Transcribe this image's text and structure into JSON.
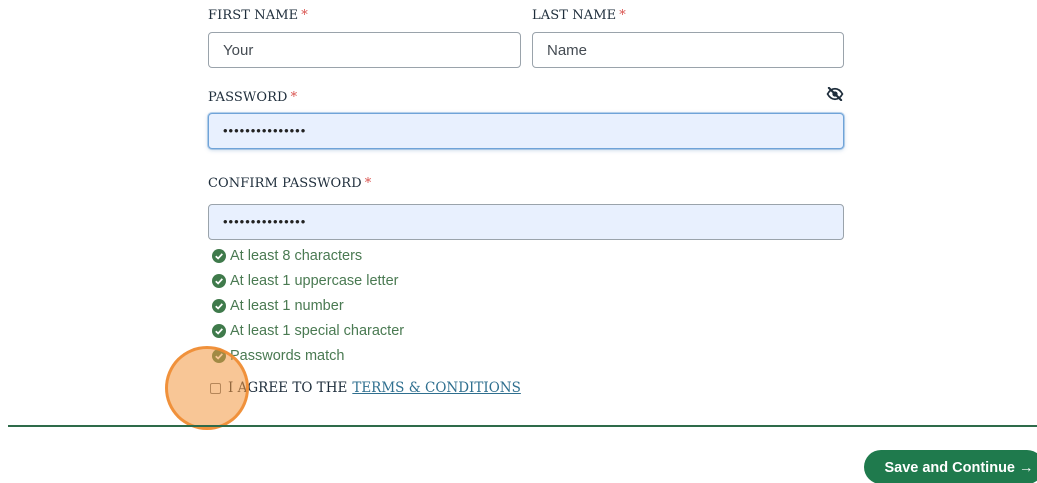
{
  "form": {
    "first_name": {
      "label": "FIRST NAME",
      "required_mark": "*",
      "value": "Your"
    },
    "last_name": {
      "label": "LAST NAME",
      "required_mark": "*",
      "value": "Name"
    },
    "password": {
      "label": "PASSWORD",
      "required_mark": "*",
      "value": "•••••••••••••••",
      "toggle_icon": "eye-slash-icon"
    },
    "confirm_password": {
      "label": "CONFIRM PASSWORD",
      "required_mark": "*",
      "value": "•••••••••••••••"
    },
    "requirements": [
      "At least 8 characters",
      "At least 1 uppercase letter",
      "At least 1 number",
      "At least 1 special character",
      "Passwords match"
    ],
    "agree": {
      "prefix": "I AGREE TO THE",
      "link": "TERMS & CONDITIONS",
      "checked": false
    }
  },
  "footer": {
    "save_label": "Save and Continue",
    "save_arrow": "→"
  },
  "colors": {
    "accent_green": "#1f7a4d",
    "check_green": "#4a7a52",
    "required_red": "#d9534f",
    "autofill_blue": "#e8f0fe",
    "link_blue": "#2f6f8f",
    "click_marker": "#f39840"
  }
}
